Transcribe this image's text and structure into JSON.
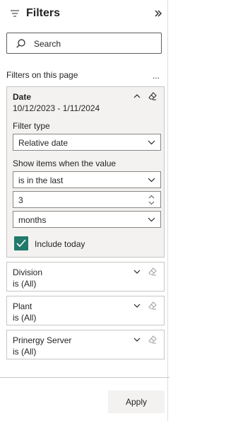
{
  "header": {
    "title": "Filters",
    "filter_icon": "filter-lines-icon",
    "collapse_icon": "double-chevron-right-icon"
  },
  "search": {
    "placeholder": "Search",
    "icon": "search-icon"
  },
  "section": {
    "label": "Filters on this page",
    "more_label": "..."
  },
  "expanded_filter": {
    "name": "Date",
    "summary": "10/12/2023 - 1/11/2024",
    "filter_type_label": "Filter type",
    "filter_type_value": "Relative date",
    "show_items_label": "Show items when the value",
    "condition_value": "is in the last",
    "number_value": "3",
    "unit_value": "months",
    "include_today_label": "Include today",
    "include_today_checked": true
  },
  "collapsed_filters": [
    {
      "name": "Division",
      "summary": "is (All)"
    },
    {
      "name": "Plant",
      "summary": "is (All)"
    },
    {
      "name": "Prinergy Server",
      "summary": "is (All)"
    }
  ],
  "footer": {
    "apply_label": "Apply"
  },
  "colors": {
    "accent": "#217a6b",
    "card_bg": "#f3f2f1",
    "border": "#c8c6c4"
  }
}
